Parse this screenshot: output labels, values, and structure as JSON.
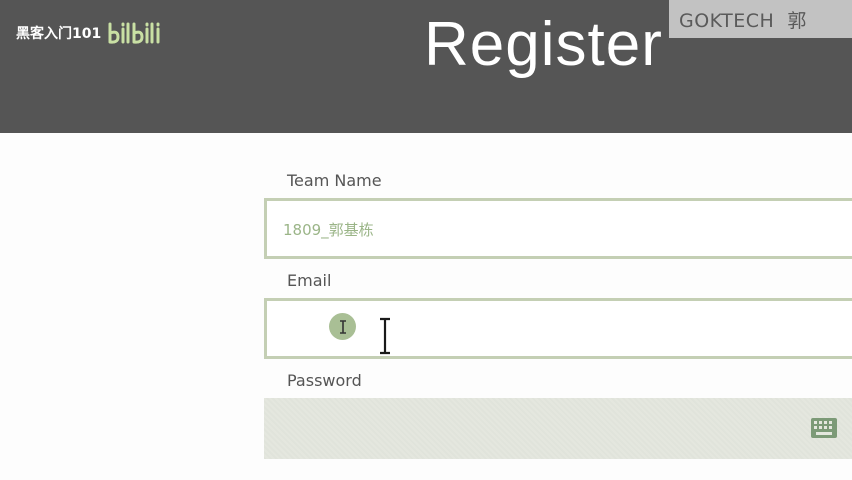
{
  "header": {
    "title": "Register"
  },
  "watermarks": {
    "left_text": "黑客入门101",
    "left_logo": "bilibili",
    "right_text": "GOKTECH  郭"
  },
  "form": {
    "team_name": {
      "label": "Team Name",
      "value": "1809_郭基栋"
    },
    "email": {
      "label": "Email",
      "value": ""
    },
    "password": {
      "label": "Password",
      "value": ""
    }
  },
  "icons": {
    "cursor_indicator": "text-cursor-icon",
    "password_keyboard": "keyboard-icon"
  },
  "colors": {
    "header_bg": "#555555",
    "title_text": "#ffffff",
    "input_border": "#c4cfb4",
    "input_text": "#9bb588",
    "label_text": "#555555",
    "password_bg": "#e4e7de",
    "accent_green": "#a9bf95"
  }
}
